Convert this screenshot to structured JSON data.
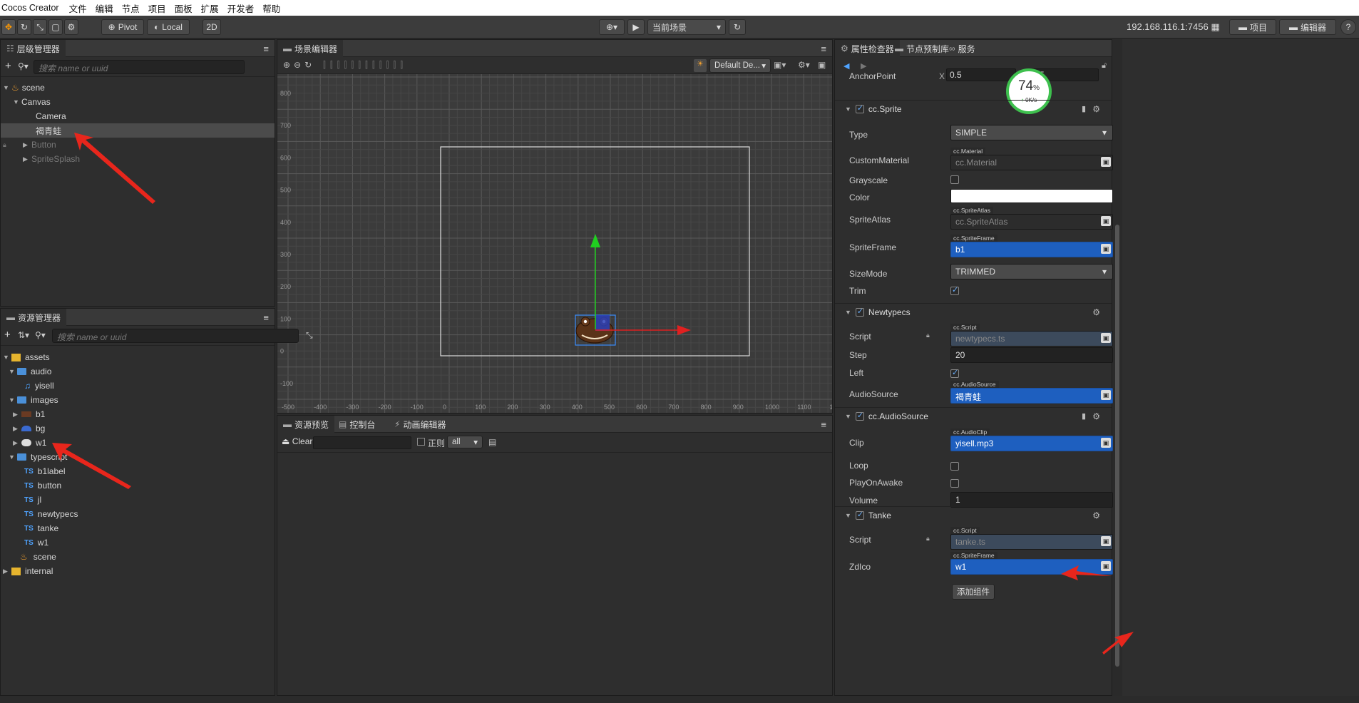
{
  "menubar": {
    "app_title": "Cocos Creator",
    "items": [
      "文件",
      "编辑",
      "节点",
      "项目",
      "面板",
      "扩展",
      "开发者",
      "帮助"
    ]
  },
  "toolbar": {
    "pivot": "Pivot",
    "local": "Local",
    "mode_2d": "2D",
    "scene_select": "当前场景",
    "ip": "192.168.116.1:7456",
    "project_button": "项目",
    "editor_button": "编辑器",
    "help": "?"
  },
  "hierarchy": {
    "title": "层级管理器",
    "search_placeholder": "搜索 name or uuid",
    "nodes": [
      "scene",
      "Canvas",
      "Camera",
      "褐青蛙",
      "Button",
      "SpriteSplash"
    ]
  },
  "assets": {
    "title": "资源管理器",
    "search_placeholder": "搜索 name or uuid",
    "items": [
      "assets",
      "audio",
      "yisell",
      "images",
      "b1",
      "bg",
      "w1",
      "typescript",
      "b1label",
      "button",
      "jl",
      "newtypecs",
      "tanke",
      "w1",
      "scene",
      "internal"
    ],
    "ts_badge": "TS"
  },
  "scene_editor": {
    "title": "场景编辑器",
    "camera_select": "Default De...",
    "y_ticks": [
      "800",
      "700",
      "600",
      "500",
      "400",
      "300",
      "200",
      "100",
      "0",
      "-100"
    ],
    "x_ticks": [
      "-500",
      "-400",
      "-300",
      "-200",
      "-100",
      "0",
      "100",
      "200",
      "300",
      "400",
      "500",
      "600",
      "700",
      "800",
      "900",
      "1000",
      "1100",
      "1"
    ]
  },
  "console": {
    "tabs": [
      "资源预览",
      "控制台",
      "动画编辑器"
    ],
    "clear": "Clear",
    "regex_label": "正则",
    "filter_select": "all"
  },
  "inspector": {
    "tabs": [
      "属性检查器",
      "节点预制库",
      "服务"
    ],
    "anchor": {
      "label": "AnchorPoint",
      "x_label": "X",
      "x": "0.5",
      "y_label": "Y",
      "y": "0.5"
    },
    "perf": {
      "percent": "74",
      "percent_unit": "%",
      "speed": "0K/s"
    },
    "sprite": {
      "title": "cc.Sprite",
      "type_label": "Type",
      "type_value": "SIMPLE",
      "material_label": "CustomMaterial",
      "material_tag": "cc.Material",
      "material_value": "cc.Material",
      "grayscale_label": "Grayscale",
      "color_label": "Color",
      "atlas_label": "SpriteAtlas",
      "atlas_tag": "cc.SpriteAtlas",
      "atlas_value": "cc.SpriteAtlas",
      "frame_label": "SpriteFrame",
      "frame_tag": "cc.SpriteFrame",
      "frame_value": "b1",
      "sizemode_label": "SizeMode",
      "sizemode_value": "TRIMMED",
      "trim_label": "Trim"
    },
    "newtypecs": {
      "title": "Newtypecs",
      "script_label": "Script",
      "script_tag": "cc.Script",
      "script_value": "newtypecs.ts",
      "step_label": "Step",
      "step_value": "20",
      "left_label": "Left",
      "audio_label": "AudioSource",
      "audio_tag": "cc.AudioSource",
      "audio_value": "褐青蛙"
    },
    "audiosource": {
      "title": "cc.AudioSource",
      "clip_label": "Clip",
      "clip_tag": "cc.AudioClip",
      "clip_value": "yisell.mp3",
      "loop_label": "Loop",
      "play_label": "PlayOnAwake",
      "volume_label": "Volume",
      "volume_value": "1"
    },
    "tanke": {
      "title": "Tanke",
      "script_label": "Script",
      "script_tag": "cc.Script",
      "script_value": "tanke.ts",
      "zdico_label": "ZdIco",
      "zdico_tag": "cc.SpriteFrame",
      "zdico_value": "w1"
    },
    "add_component": "添加组件"
  },
  "colors": {
    "accent": "#1e5fbf",
    "annotation": "#e8261c",
    "gizmo_x": "#e02020",
    "gizmo_y": "#20d020"
  }
}
